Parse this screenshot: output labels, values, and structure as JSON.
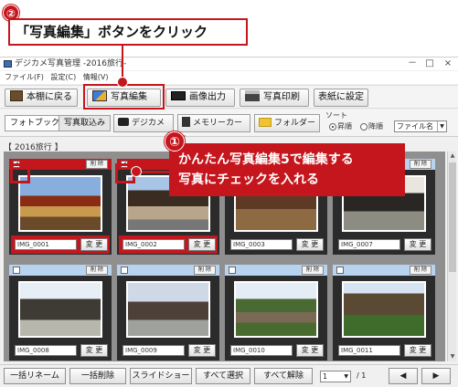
{
  "callout_edit": {
    "step": "②",
    "text": "「写真編集」ボタンをクリック"
  },
  "callout_check": {
    "step": "①",
    "line1": "かんたん写真編集5で編集する",
    "line2": "写真にチェックを入れる"
  },
  "window": {
    "title": "デジカメ写真管理 -2016旅行-",
    "controls": [
      "－",
      "□",
      "×"
    ],
    "menu": [
      "ファイル(F)",
      "設定(C)",
      "情報(V)"
    ]
  },
  "toolbar": {
    "back": "本棚に戻る",
    "edit": "写真編集",
    "output": "画像出力",
    "print": "写真印刷",
    "cover": "表紙に設定"
  },
  "import_bar": {
    "tab_photobook": "フォトブック",
    "tab_import": "写真取込み",
    "camera": "デジカメ",
    "memory_card": "メモリーカード",
    "folder": "フォルダー",
    "sort_label": "ソート",
    "asc": "昇順",
    "desc": "降順",
    "sort_field": "ファイル名"
  },
  "album_label": "【 2016旅行 】",
  "photos": [
    {
      "name": "IMG_0001",
      "checked": true
    },
    {
      "name": "IMG_0002",
      "checked": true
    },
    {
      "name": "IMG_0003",
      "checked": false
    },
    {
      "name": "IMG_0007",
      "checked": false
    },
    {
      "name": "IMG_0008",
      "checked": false
    },
    {
      "name": "IMG_0009",
      "checked": false
    },
    {
      "name": "IMG_0010",
      "checked": false
    },
    {
      "name": "IMG_0011",
      "checked": false
    }
  ],
  "card": {
    "delete": "削 除",
    "change": "変 更",
    "check_mark": "✔"
  },
  "bottom": {
    "rename": "一括リネーム",
    "bulk_delete": "一括削除",
    "slideshow": "スライドショー",
    "select_all": "すべて選択",
    "deselect_all": "すべて解除",
    "page": "1",
    "page_total": "/ 1",
    "prev": "◀",
    "next": "▶"
  },
  "colors": {
    "accent": "#c4161c",
    "strip": "#b7d3ef"
  }
}
